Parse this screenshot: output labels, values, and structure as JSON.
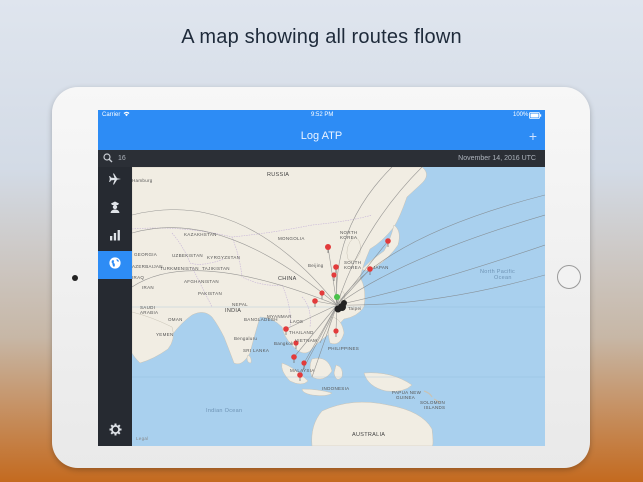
{
  "caption": "A map showing all routes flown",
  "status": {
    "carrier": "Carrier",
    "time": "9:52 PM",
    "battery": "100%"
  },
  "nav": {
    "title": "Log ATP",
    "add": "+"
  },
  "search": {
    "value": "16",
    "date": "November 14, 2016 UTC"
  },
  "sidebar": {
    "items": [
      {
        "icon": "airplane-icon"
      },
      {
        "icon": "pilot-icon"
      },
      {
        "icon": "bar-chart-icon"
      },
      {
        "icon": "globe-icon",
        "active": true
      }
    ],
    "settings_icon": "gear-icon"
  },
  "map": {
    "labels": {
      "russia": "RUSSIA",
      "kazakhstan": "KAZAKHSTAN",
      "mongolia": "MONGOLIA",
      "uzbekistan": "UZBEKISTAN",
      "kyrgyzstan": "KYRGYZSTAN",
      "georgia": "GEORGIA",
      "azerbaijan": "AZERBAIJAN",
      "turkmenistan": "TURKMENISTAN",
      "tajikistan": "TAJIKISTAN",
      "afghanistan": "AFGHANISTAN",
      "iran": "IRAN",
      "iraq": "IRAQ",
      "pakistan": "PAKISTAN",
      "china": "CHINA",
      "nepal": "NEPAL",
      "india": "INDIA",
      "saudi": "SAUDI",
      "arabia": "ARABIA",
      "oman": "OMAN",
      "yemen": "YEMEN",
      "myanmar": "MYANMAR",
      "laos": "LAOS",
      "thailand": "THAILAND",
      "vietnam": "VIETNAM",
      "bangladesh": "BANGLADESH",
      "srilanka": "SRI LANKA",
      "philippines": "PHILIPPINES",
      "malaysia": "MALAYSIA",
      "indonesia": "INDONESIA",
      "png": "PAPUA NEW",
      "guinea": "GUINEA",
      "solomon": "SOLOMON",
      "islands": "ISLANDS",
      "australia": "AUSTRALIA",
      "japan": "JAPAN",
      "north_korea": "NORTH",
      "korea": "KOREA",
      "south_korea": "SOUTH",
      "beijing": "Beijing",
      "shanghai": "Shanghai",
      "singapore": "Singapore",
      "bangkok": "Bangkok",
      "tokyo": "Tokyo",
      "seoul": "Seoul",
      "taipei": "Taipei",
      "hamburg": "Hamburg",
      "bengaluru": "Bengaluru",
      "indian_ocean": "Indian Ocean",
      "north_pacific": "North Pacific",
      "ocean": "Ocean",
      "legal": "Legal"
    }
  },
  "colors": {
    "accent": "#2d8cf5",
    "sidebar": "#262a31",
    "water": "#a9d0ee",
    "land": "#f1ede3",
    "pin": "#e23b3b",
    "pin_home": "#49c24a"
  }
}
